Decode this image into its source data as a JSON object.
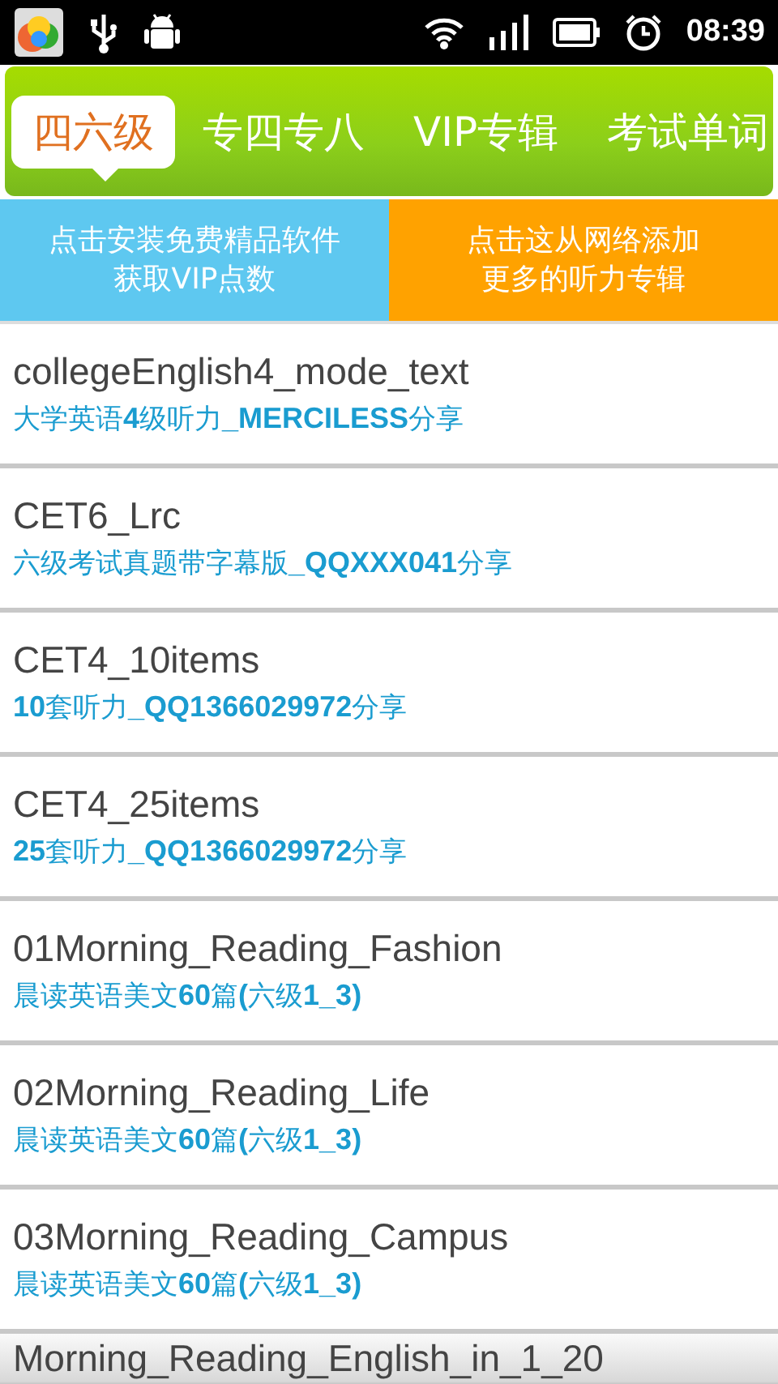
{
  "status_bar": {
    "time": "08:39"
  },
  "tabs": [
    {
      "label": "四六级",
      "selected": true
    },
    {
      "label": "专四专八",
      "selected": false
    },
    {
      "label": "VIP专辑",
      "selected": false
    },
    {
      "label": "考试单词",
      "selected": false
    }
  ],
  "actions": [
    {
      "kind": "install",
      "lines": [
        "点击安装免费精品软件",
        "获取VIP点数"
      ]
    },
    {
      "kind": "add",
      "lines": [
        "点击这从网络添加",
        "更多的听力专辑"
      ]
    }
  ],
  "albums": [
    {
      "title": "collegeEnglish4_mode_text",
      "subtitle": "大学英语**4**级听力**_MERCILESS**分享"
    },
    {
      "title": "CET6_Lrc",
      "subtitle": "六级考试真题带字幕版**_QQXXX041**分享"
    },
    {
      "title": "CET4_10items",
      "subtitle": "**10**套听力**_QQ1366029972**分享"
    },
    {
      "title": "CET4_25items",
      "subtitle": "**25**套听力**_QQ1366029972**分享"
    },
    {
      "title": "01Morning_Reading_Fashion",
      "subtitle": "晨读英语美文**60**篇**(**六级**1_3)**"
    },
    {
      "title": "02Morning_Reading_Life",
      "subtitle": "晨读英语美文**60**篇**(**六级**1_3)**"
    },
    {
      "title": "03Morning_Reading_Campus",
      "subtitle": "晨读英语美文**60**篇**(**六级**1_3)**"
    },
    {
      "title": "Morning_Reading_English_in_1_20"
    }
  ]
}
